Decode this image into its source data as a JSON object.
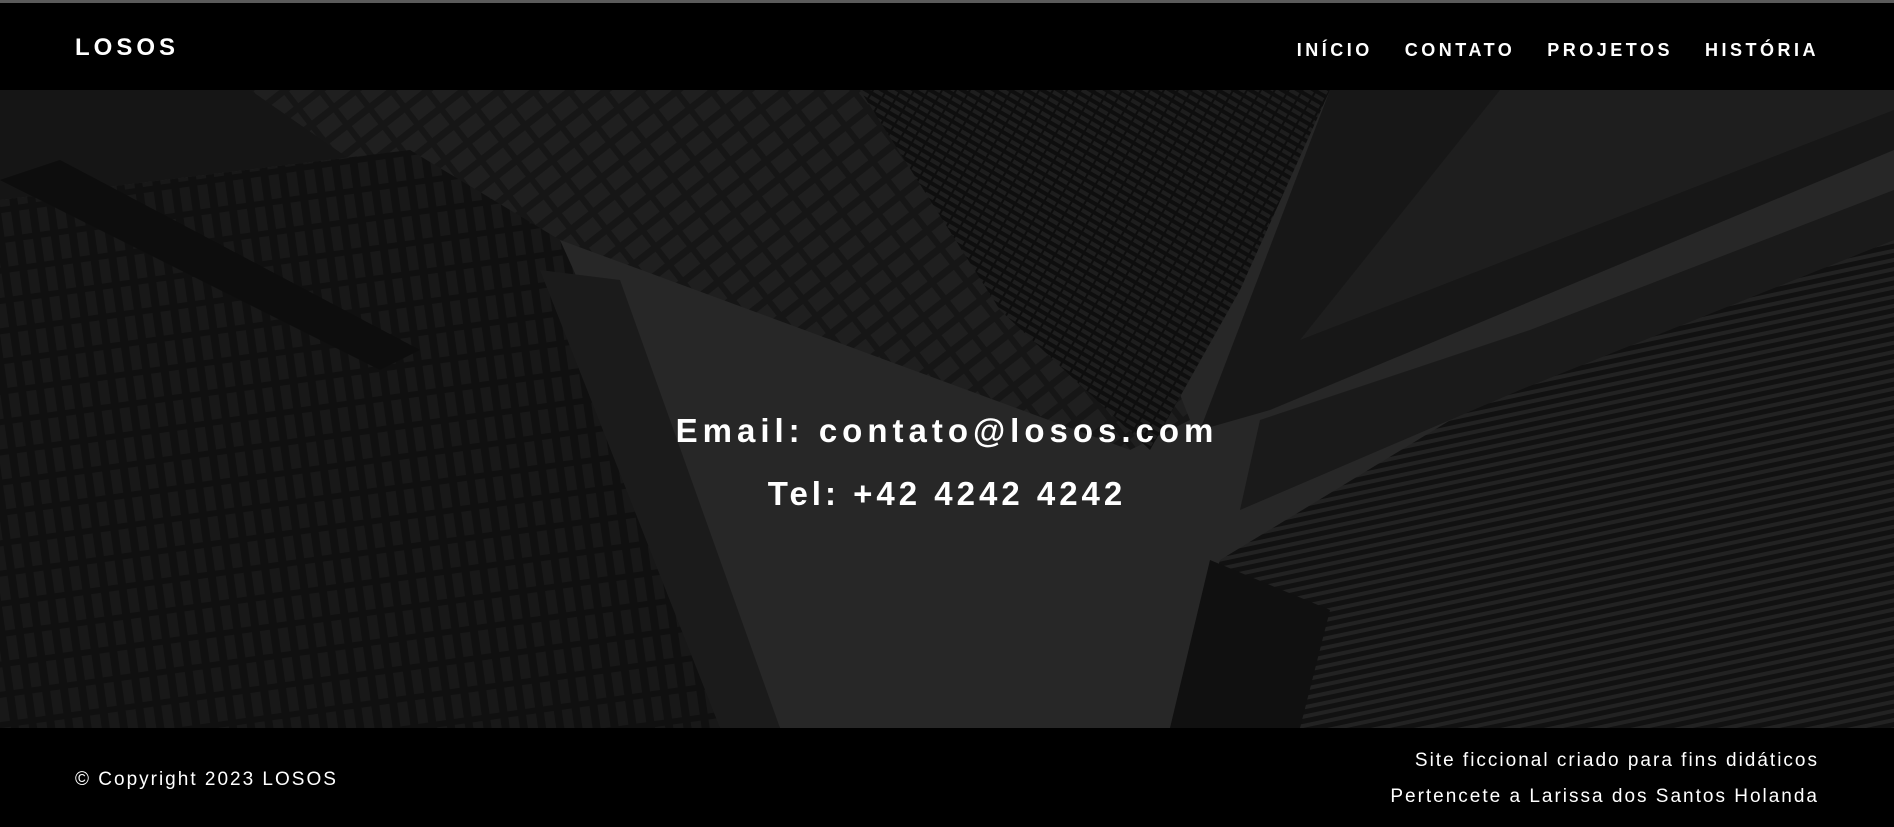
{
  "header": {
    "logo": "LOSOS",
    "nav": [
      {
        "label": "INÍCIO"
      },
      {
        "label": "CONTATO"
      },
      {
        "label": "PROJETOS"
      },
      {
        "label": "HISTÓRIA"
      }
    ]
  },
  "hero": {
    "email": "Email: contato@losos.com",
    "tel": "Tel: +42 4242 4242"
  },
  "footer": {
    "copyright": "© Copyright 2023 LOSOS",
    "note_line1": "Site ficcional criado para fins didáticos",
    "note_line2": "Pertencete a Larissa dos Santos Holanda"
  },
  "colors": {
    "background": "#000000",
    "text": "#ffffff",
    "hero_sky": "#2d2d2d"
  }
}
